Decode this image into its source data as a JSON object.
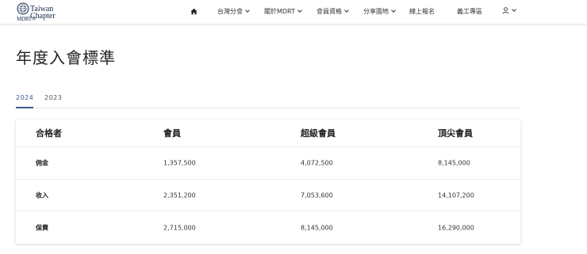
{
  "header": {
    "logo": {
      "line1": "Taiwan",
      "line2": "Chapter",
      "brand": "MDRT®"
    },
    "nav": [
      {
        "label": "台灣分會",
        "dropdown": true
      },
      {
        "label": "關於MDRT",
        "dropdown": true
      },
      {
        "label": "會員資格",
        "dropdown": true
      },
      {
        "label": "分享園地",
        "dropdown": true
      },
      {
        "label": "線上報名",
        "dropdown": false
      },
      {
        "label": "義工專區",
        "dropdown": false
      }
    ]
  },
  "page": {
    "title": "年度入會標準"
  },
  "tabs": [
    {
      "label": "2024",
      "active": true
    },
    {
      "label": "2023",
      "active": false
    }
  ],
  "table": {
    "headers": [
      "合格者",
      "會員",
      "超級會員",
      "頂尖會員"
    ],
    "rows": [
      [
        "佣金",
        "1,357,500",
        "4,072,500",
        "8,145,000"
      ],
      [
        "收入",
        "2,351,200",
        "7,053,600",
        "14,107,200"
      ],
      [
        "保費",
        "2,715,000",
        "8,145,000",
        "16,290,000"
      ]
    ]
  },
  "colors": {
    "brand_navy": "#13284b",
    "tab_active": "#3a5a8c"
  }
}
